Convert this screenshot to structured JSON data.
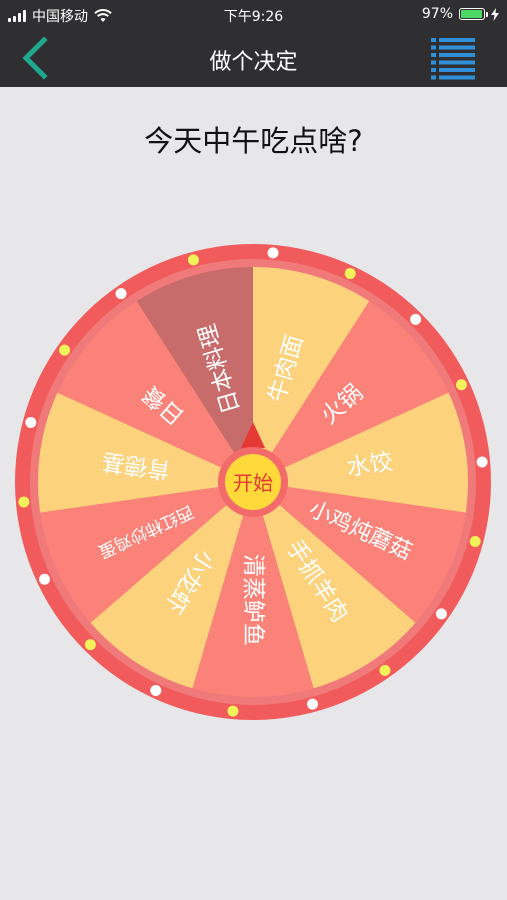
{
  "status_bar": {
    "carrier": "中国移动",
    "time": "下午9:26",
    "battery_percent": "97%",
    "battery_level": 0.97,
    "battery_color": "#4cd964"
  },
  "nav": {
    "title": "做个决定",
    "back_icon": "chevron-left-icon",
    "menu_icon": "list-icon",
    "accent": "#1fa88f",
    "menu_accent": "#2f8fd9"
  },
  "question": "今天中午吃点啥?",
  "wheel": {
    "start_label": "开始",
    "rim_color": "#f25b5b",
    "center_color": "#ffd93a",
    "segments": [
      {
        "label": "牛肉面",
        "color": "#fcd27c"
      },
      {
        "label": "火锅",
        "color": "#fa8278"
      },
      {
        "label": "水饺",
        "color": "#fcd27c"
      },
      {
        "label": "小鸡炖蘑菇",
        "color": "#fa8278"
      },
      {
        "label": "手抓羊肉",
        "color": "#fcd27c"
      },
      {
        "label": "清蒸鲈鱼",
        "color": "#fa8278"
      },
      {
        "label": "小龙虾",
        "color": "#fcd27c"
      },
      {
        "label": "西红柿炒鸡蛋",
        "color": "#fa8278"
      },
      {
        "label": "肯德基",
        "color": "#fcd27c"
      },
      {
        "label": "日餐",
        "color": "#fa8278"
      },
      {
        "label": "日本料理",
        "color": "#c86b6b"
      }
    ]
  }
}
